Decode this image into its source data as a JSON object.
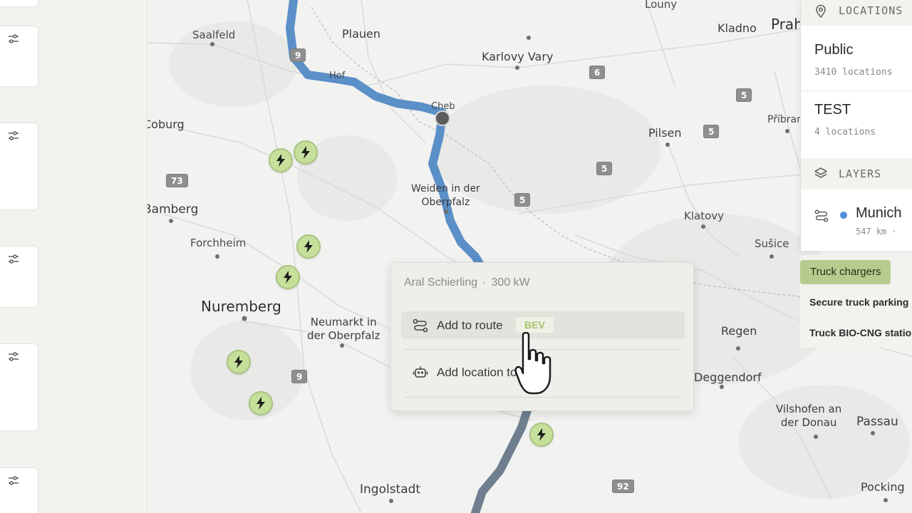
{
  "sidebar": {
    "card_count": 5,
    "filter_icon": "sliders-icon"
  },
  "map": {
    "cities": {
      "louny": "Louny",
      "saalfeld": "Saalfeld",
      "plauen": "Plauen",
      "kladno": "Kladno",
      "praha": "Praha",
      "karlovy_vary": "Karlovy Vary",
      "hof": "Hof",
      "cheb": "Cheb",
      "coburg": "Coburg",
      "pribram": "Příbram",
      "pilsen": "Pilsen",
      "weiden": "Weiden in der\nOberpfalz",
      "bamberg": "Bamberg",
      "klatovy": "Klatovy",
      "forchheim": "Forchheim",
      "susice": "Sušice",
      "nuremberg": "Nuremberg",
      "neumarkt": "Neumarkt in\nder Oberpfalz",
      "regen": "Regen",
      "deggendorf": "Deggendorf",
      "vilshofen": "Vilshofen an\nder Donau",
      "passau": "Passau",
      "ingolstadt": "Ingolstadt",
      "pocking": "Pocking"
    },
    "road_shields": [
      "9",
      "6",
      "5",
      "5",
      "73",
      "5",
      "5",
      "9",
      "92"
    ],
    "charger_icon": "lightning-icon",
    "route_color": "#5b8fc7",
    "charger_color": "#c6e09c"
  },
  "popup": {
    "station_name": "Aral Schierling",
    "separator": "·",
    "power": "300 kW",
    "add_to_route_label": "Add to route",
    "vehicle_badge": "BEV",
    "add_location_label": "Add location to chat",
    "route_icon": "route-icon",
    "chat_icon": "bot-icon"
  },
  "panel": {
    "locations_header": "LOCATIONS",
    "locations": [
      {
        "name": "Public",
        "count": "3410 locations"
      },
      {
        "name": "TEST",
        "count": "4 locations"
      }
    ],
    "layers_header": "LAYERS",
    "layer": {
      "name": "Munich",
      "meta": "547 km ·",
      "color": "#4d8ed8"
    }
  },
  "filters": {
    "truck_chargers": "Truck chargers",
    "secure_parking": "Secure truck parking",
    "bio_cng": "Truck BIO-CNG stations"
  }
}
